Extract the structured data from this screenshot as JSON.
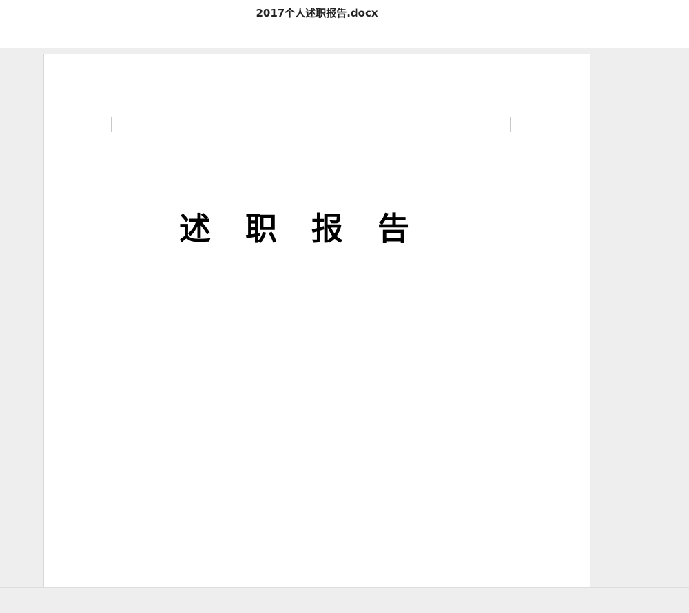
{
  "header": {
    "filename": "2017个人述职报告.docx"
  },
  "document": {
    "heading": "述职报告"
  },
  "colors": {
    "viewer_background": "#eeeeee",
    "page_background": "#ffffff",
    "text": "#000000"
  }
}
